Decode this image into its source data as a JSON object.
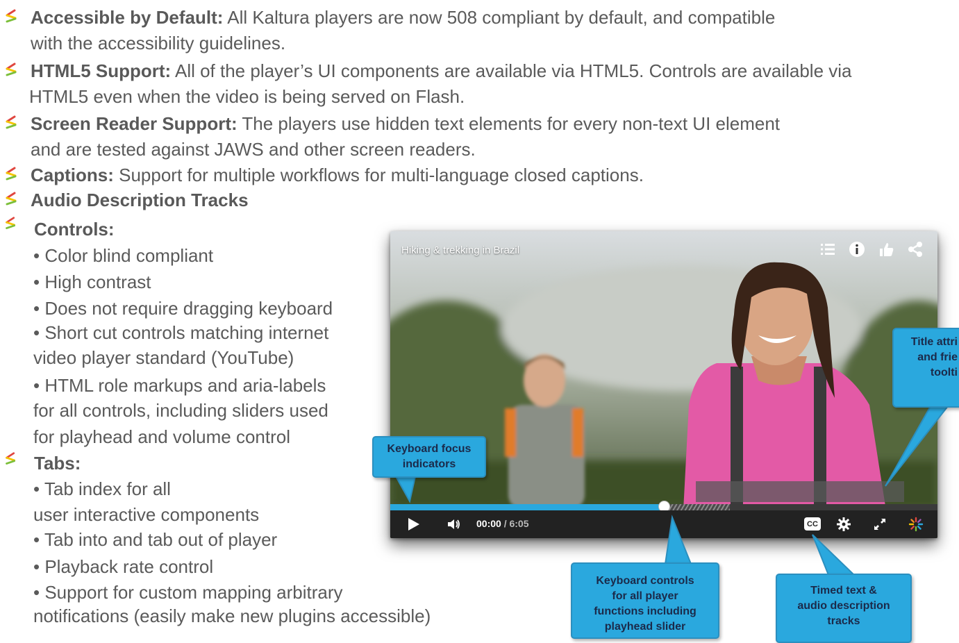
{
  "features": [
    {
      "bold": "Accessible by Default:",
      "rest": " All Kaltura players are now 508 compliant by default, and compatible",
      "line2": "with the accessibility guidelines."
    },
    {
      "bold": "HTML5 Support:",
      "rest": " All of the player’s UI components are available via HTML5. Controls are available via",
      "line2": "HTML5 even when the video is being served on Flash."
    },
    {
      "bold": "Screen Reader Support:",
      "rest": " The players use hidden text elements for every non-text UI element",
      "line2": "and are tested against JAWS and other screen readers."
    },
    {
      "bold": "Captions:",
      "rest": " Support for multiple workflows for multi-language closed captions.",
      "line2": ""
    },
    {
      "bold": "Audio Description Tracks",
      "rest": "",
      "line2": ""
    }
  ],
  "controls": {
    "heading": "Controls:",
    "lines": [
      "• Color blind compliant",
      "• High contrast",
      "• Does not require dragging keyboard",
      "• Short cut controls matching internet",
      "video player standard (YouTube)",
      "• HTML role markups and aria-labels",
      "for all controls, including sliders used",
      "for playhead and volume control"
    ]
  },
  "tabs": {
    "heading": "Tabs:",
    "lines": [
      "• Tab index for all",
      "user interactive components",
      "• Tab into and tab out of player",
      "• Playback rate control",
      "• Support for custom mapping arbitrary",
      "notifications (easily make new plugins accessible)"
    ]
  },
  "player": {
    "title": "Hiking & trekking in Brazil",
    "current_time": "00:00",
    "total_time": " / 6:05",
    "cc_label": "CC",
    "progress_fraction": 0.5,
    "top_icons": [
      "playlist-icon",
      "info-icon",
      "like-icon",
      "share-icon"
    ]
  },
  "callouts": {
    "focus": [
      "Keyboard focus",
      "indicators"
    ],
    "tooltip": [
      "Title attri",
      "and frie",
      "toolti"
    ],
    "keyboard": [
      "Keyboard controls",
      "for all player",
      "functions including",
      "playhead slider"
    ],
    "timed": [
      "Timed text &",
      "audio description",
      "tracks"
    ]
  },
  "colors": {
    "accent": "#2aa8de",
    "text": "#5a5a5a",
    "bullet_red": "#e0463f",
    "bullet_yellow": "#f5c400",
    "bullet_green": "#7cbf3a"
  }
}
